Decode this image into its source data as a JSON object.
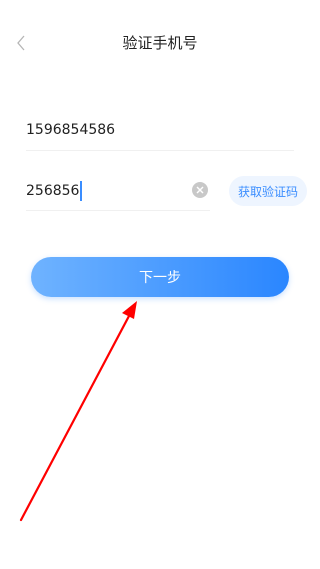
{
  "header": {
    "title": "验证手机号",
    "back_icon": "chevron-left-icon"
  },
  "form": {
    "phone": {
      "value": "1596854586"
    },
    "code": {
      "value": "256856",
      "clear_icon": "clear-circle-icon"
    },
    "get_code_label": "获取验证码",
    "next_label": "下一步"
  },
  "colors": {
    "accent": "#3a8dff",
    "button_gradient_start": "#6fb3ff",
    "button_gradient_end": "#2a86ff",
    "annotation": "#ff0000"
  }
}
